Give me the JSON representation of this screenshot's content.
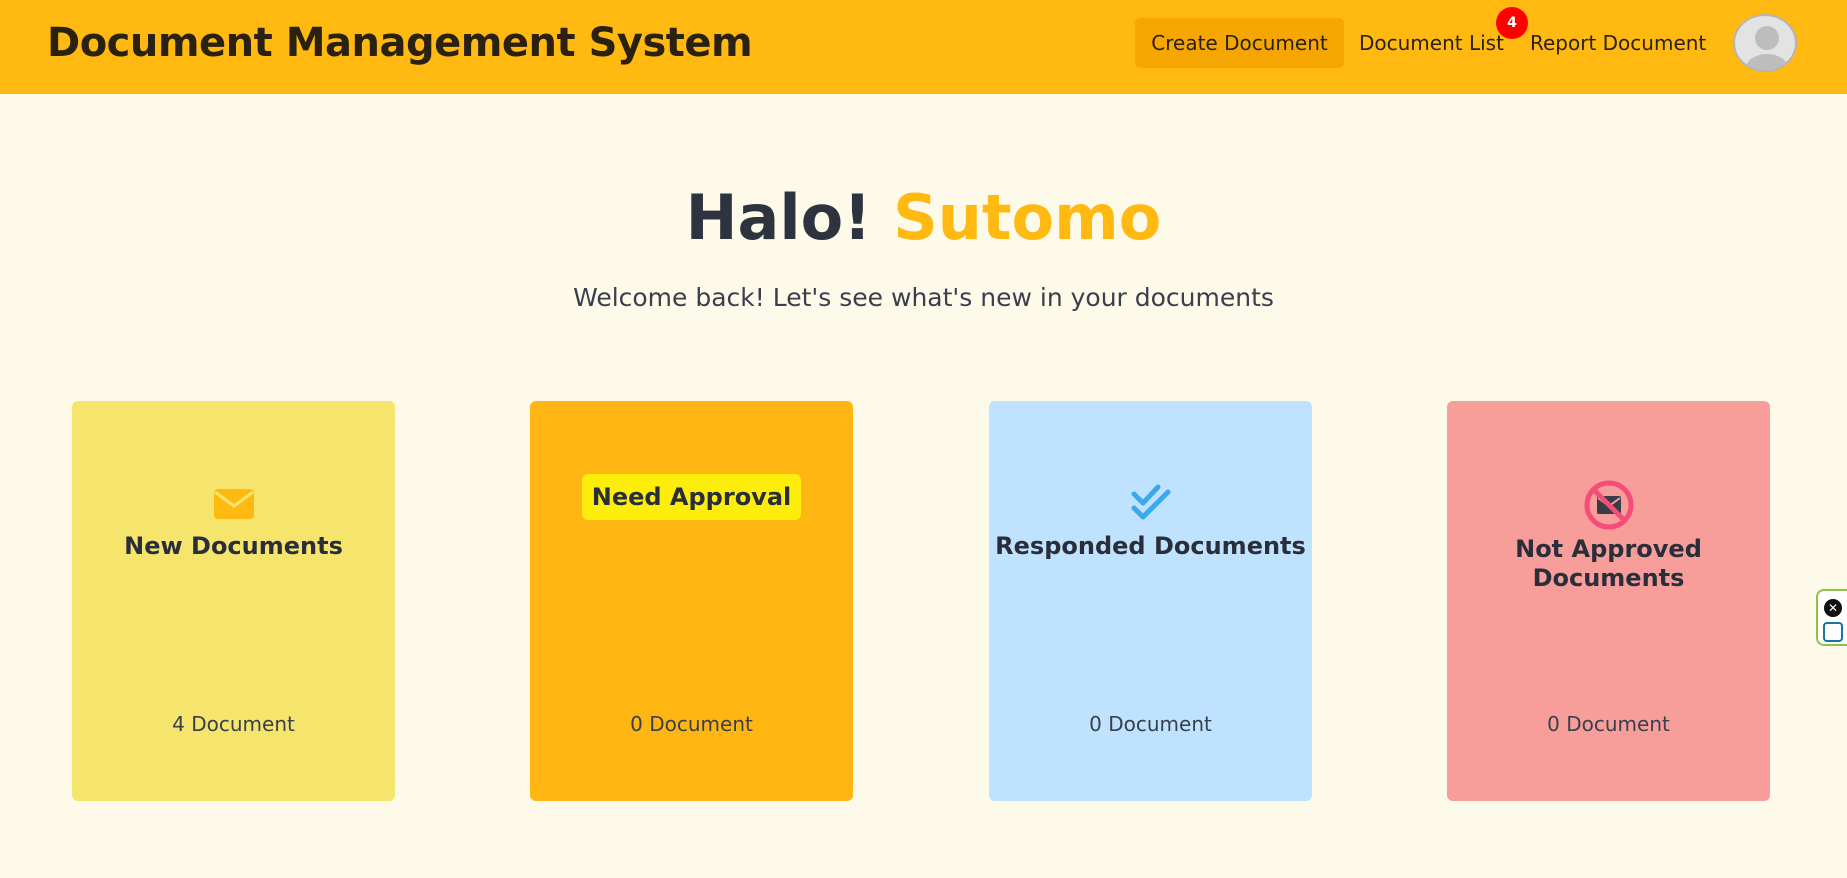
{
  "header": {
    "title": "Document Management System",
    "nav": {
      "create": "Create Document",
      "list": "Document List",
      "list_badge": "4",
      "report": "Report Document"
    }
  },
  "hero": {
    "greeting": "Halo!",
    "name": "Sutomo",
    "subtitle": "Welcome back! Let's see what's new in your documents"
  },
  "cards": [
    {
      "title": "New Documents",
      "count": "4 Document",
      "icon": "envelope-icon",
      "color": "#f6e56d"
    },
    {
      "title": "Need Approval",
      "count": "0 Document",
      "icon": "none",
      "color": "#ffb512"
    },
    {
      "title": "Responded Documents",
      "count": "0 Document",
      "icon": "double-check-icon",
      "color": "#bfe2fe"
    },
    {
      "title": "Not Approved Documents",
      "count": "0 Document",
      "icon": "envelope-blocked-icon",
      "color": "#f79e9b"
    }
  ],
  "colors": {
    "brand": "#ffb911",
    "page_bg": "#fefaea",
    "badge": "#ff0000",
    "text": "#2e3340"
  }
}
